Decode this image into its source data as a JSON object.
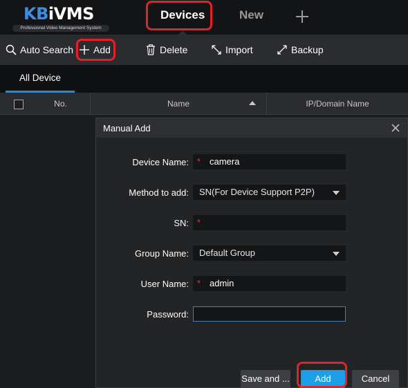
{
  "app": {
    "logo_brand_prefix": "KB",
    "logo_brand_suffix": "iVMS",
    "logo_tagline": "Professional Video Management System",
    "tabs": [
      {
        "label": "Devices",
        "active": true
      },
      {
        "label": "New",
        "active": false
      }
    ],
    "add_tab_icon": "plus-icon"
  },
  "toolbar": {
    "auto_search": {
      "label": "Auto Search",
      "icon": "search-icon"
    },
    "add": {
      "label": "Add",
      "icon": "plus-icon"
    },
    "delete": {
      "label": "Delete",
      "icon": "trash-icon"
    },
    "import": {
      "label": "Import",
      "icon": "import-icon"
    },
    "backup": {
      "label": "Backup",
      "icon": "backup-icon"
    }
  },
  "device_tabs": [
    {
      "label": "All Device",
      "active": true
    }
  ],
  "table": {
    "columns": [
      "No.",
      "Name",
      "IP/Domain Name"
    ],
    "sort_column": "Name",
    "sort_direction": "ascending"
  },
  "dialog": {
    "title": "Manual Add",
    "fields": {
      "device_name": {
        "label": "Device Name:",
        "value": "camera",
        "required": true
      },
      "method": {
        "label": "Method to add:",
        "value": "SN(For Device Support P2P)"
      },
      "sn": {
        "label": "SN:",
        "value": "",
        "required": true
      },
      "group": {
        "label": "Group Name:",
        "value": "Default Group"
      },
      "user": {
        "label": "User Name:",
        "value": "admin",
        "required": true
      },
      "password": {
        "label": "Password:",
        "value": ""
      }
    },
    "required_mark": "*",
    "buttons": {
      "save_and": "Save and ...",
      "add": "Add",
      "cancel": "Cancel"
    }
  },
  "colors": {
    "accent": "#1a9fe8",
    "brand_blue": "#3a8fe0",
    "highlight": "#e8202a",
    "background": "#1b1c1e"
  }
}
